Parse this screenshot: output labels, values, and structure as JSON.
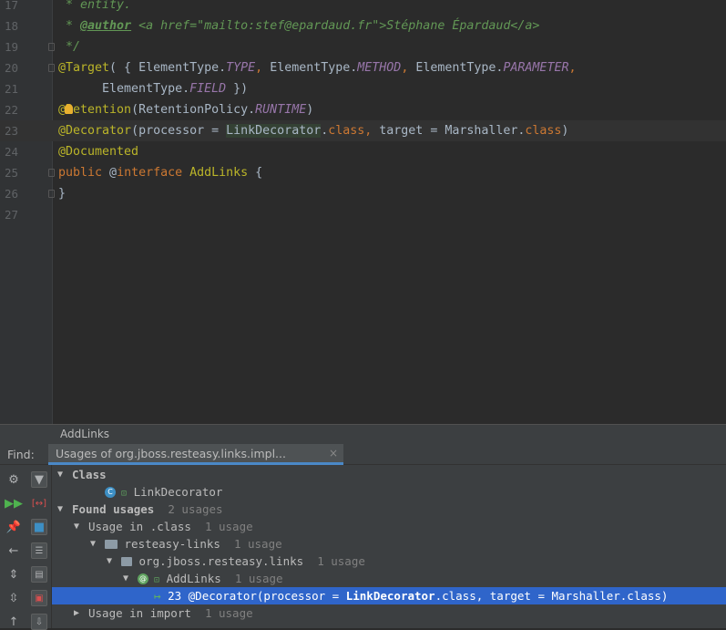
{
  "editor": {
    "lines": [
      {
        "num": "17",
        "parts": [
          {
            "t": " * entity.",
            "c": "c-doc"
          }
        ]
      },
      {
        "num": "18",
        "parts": [
          {
            "t": " * ",
            "c": "c-doc"
          },
          {
            "t": "@author",
            "c": "c-tag"
          },
          {
            "t": " ",
            "c": "c-doc"
          },
          {
            "t": "<a href=\"mailto:stef@epardaud.fr\">",
            "c": "c-doc"
          },
          {
            "t": "Stéphane Épardaud",
            "c": "c-doc"
          },
          {
            "t": "</a>",
            "c": "c-doc"
          }
        ]
      },
      {
        "num": "19",
        "parts": [
          {
            "t": " */",
            "c": "c-doc"
          }
        ]
      },
      {
        "num": "20",
        "parts": [
          {
            "t": "@Target",
            "c": "c-ann"
          },
          {
            "t": "( { ElementType.",
            "c": "c-cls"
          },
          {
            "t": "TYPE",
            "c": "c-const"
          },
          {
            "t": ", ",
            "c": "c-kw"
          },
          {
            "t": "ElementType.",
            "c": "c-cls"
          },
          {
            "t": "METHOD",
            "c": "c-const"
          },
          {
            "t": ", ",
            "c": "c-kw"
          },
          {
            "t": "ElementType.",
            "c": "c-cls"
          },
          {
            "t": "PARAMETER",
            "c": "c-const"
          },
          {
            "t": ",",
            "c": "c-kw"
          }
        ]
      },
      {
        "num": "21",
        "parts": [
          {
            "t": "      ElementType.",
            "c": "c-cls"
          },
          {
            "t": "FIELD",
            "c": "c-const"
          },
          {
            "t": " })",
            "c": "c-cls"
          }
        ]
      },
      {
        "num": "22",
        "parts": [
          {
            "t": "@",
            "c": "c-ann"
          },
          {
            "t": "",
            "c": "bulb"
          },
          {
            "t": "Retention",
            "c": "c-ann"
          },
          {
            "t": "(RetentionPolicy.",
            "c": "c-cls"
          },
          {
            "t": "RUNTIME",
            "c": "c-const"
          },
          {
            "t": ")",
            "c": "c-cls"
          }
        ]
      },
      {
        "num": "23",
        "parts": [
          {
            "t": "@Decorator",
            "c": "c-ann"
          },
          {
            "t": "(processor = ",
            "c": "c-cls"
          },
          {
            "t": "LinkDecorator",
            "c": "c-ref"
          },
          {
            "t": ".",
            "c": "c-cls"
          },
          {
            "t": "class",
            "c": "c-kw"
          },
          {
            "t": ", ",
            "c": "c-kw"
          },
          {
            "t": "target = Marshaller.",
            "c": "c-cls"
          },
          {
            "t": "class",
            "c": "c-kw"
          },
          {
            "t": ")",
            "c": "c-cls"
          }
        ]
      },
      {
        "num": "24",
        "parts": [
          {
            "t": "@Documented",
            "c": "c-ann"
          }
        ]
      },
      {
        "num": "25",
        "parts": [
          {
            "t": "public ",
            "c": "c-kw"
          },
          {
            "t": "@",
            "c": "c-cls"
          },
          {
            "t": "interface ",
            "c": "c-kw"
          },
          {
            "t": "AddLinks",
            "c": "c-ann"
          },
          {
            "t": " {",
            "c": "c-cls"
          }
        ]
      },
      {
        "num": "26",
        "parts": [
          {
            "t": "}",
            "c": "c-cls"
          }
        ]
      },
      {
        "num": "27",
        "parts": []
      }
    ]
  },
  "breadcrumb": {
    "label": "AddLinks"
  },
  "find": {
    "label": "Find:",
    "tab_title": "Usages of org.jboss.resteasy.links.impl...",
    "close_glyph": "×"
  },
  "toolbar_icons": [
    "gear-icon",
    "filter-icon",
    "rerun-icon",
    "merge-icon",
    "pin-icon",
    "module-group-icon",
    "back-icon",
    "package-group-icon",
    "expand-all-icon",
    "file-group-icon",
    "collapse-all-icon",
    "preview-icon",
    "up-icon",
    "export-icon"
  ],
  "tree": [
    {
      "label": "Class",
      "bold": true,
      "level": 0,
      "arrow": "▼"
    },
    {
      "label": "LinkDecorator",
      "level": 2,
      "icon": "class-icon"
    },
    {
      "label": "Found usages",
      "bold": true,
      "count": "2 usages",
      "level": 0,
      "arrow": "▼"
    },
    {
      "label": "Usage in .class",
      "count": "1 usage",
      "level": 1,
      "arrow": "▼"
    },
    {
      "label": "resteasy-links",
      "count": "1 usage",
      "level": 2,
      "arrow": "▼",
      "icon": "module-icon"
    },
    {
      "label": "org.jboss.resteasy.links",
      "count": "1 usage",
      "level": 3,
      "arrow": "▼",
      "icon": "package-icon"
    },
    {
      "label": "AddLinks",
      "count": "1 usage",
      "level": 4,
      "arrow": "▼",
      "icon": "annotation-icon"
    },
    {
      "label": "23 @Decorator(processor = ",
      "bold_part": "LinkDecorator",
      "tail": ".class, target = Marshaller.class)",
      "level": 5,
      "selected": true,
      "icon": "usage-icon"
    },
    {
      "label": "Usage in import",
      "count": "1 usage",
      "level": 1,
      "arrow": "▶"
    }
  ]
}
